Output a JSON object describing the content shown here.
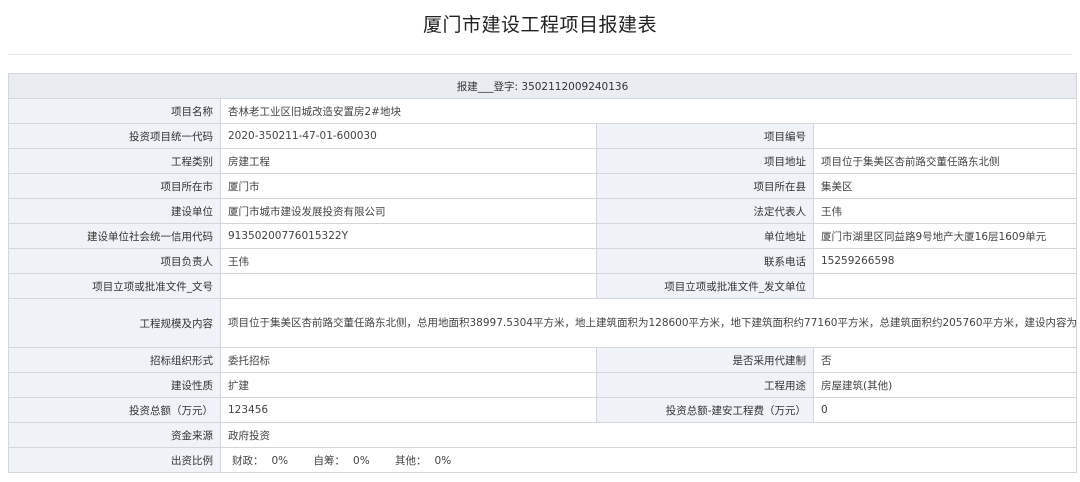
{
  "title": "厦门市建设工程项目报建表",
  "registration": {
    "prefix": "报建",
    "blank": "___",
    "suffix": "登字:",
    "number": "3502112009240136"
  },
  "rows": {
    "project_name": {
      "label": "项目名称",
      "value": "杏林老工业区旧城改造安置房2#地块"
    },
    "investment_code": {
      "label": "投资项目统一代码",
      "value": "2020-350211-47-01-600030"
    },
    "project_number": {
      "label": "项目编号",
      "value": ""
    },
    "engineering_category": {
      "label": "工程类别",
      "value": "房建工程"
    },
    "project_address": {
      "label": "项目地址",
      "value": "项目位于集美区杏前路交董任路东北侧"
    },
    "city": {
      "label": "项目所在市",
      "value": "厦门市"
    },
    "county": {
      "label": "项目所在县",
      "value": "集美区"
    },
    "construction_unit": {
      "label": "建设单位",
      "value": "厦门市城市建设发展投资有限公司"
    },
    "legal_rep": {
      "label": "法定代表人",
      "value": "王伟"
    },
    "credit_code": {
      "label": "建设单位社会统一信用代码",
      "value": "91350200776015322Y"
    },
    "unit_address": {
      "label": "单位地址",
      "value": "厦门市湖里区同益路9号地产大厦16层1609单元"
    },
    "project_leader": {
      "label": "项目负责人",
      "value": "王伟"
    },
    "phone": {
      "label": "联系电话",
      "value": "15259266598"
    },
    "approval_doc_no": {
      "label": "项目立项或批准文件_文号",
      "value": ""
    },
    "approval_doc_unit": {
      "label": "项目立项或批准文件_发文单位",
      "value": ""
    },
    "scale": {
      "label": "工程规模及内容",
      "value": "项目位于集美区杏前路交董任路东北侧，总用地面积38997.5304平方米，地上建筑面积为128600平方米，地下建筑面积约77160平方米，总建筑面积约205760平方米，建设内容为安置房及配建生鲜超市便利店、物流配送站（电商物流）。"
    },
    "bidding_form": {
      "label": "招标组织形式",
      "value": "委托招标"
    },
    "agent_system": {
      "label": "是否采用代建制",
      "value": "否"
    },
    "nature": {
      "label": "建设性质",
      "value": "扩建"
    },
    "usage": {
      "label": "工程用途",
      "value": "房屋建筑(其他)"
    },
    "total_investment": {
      "label": "投资总额（万元）",
      "value": "123456"
    },
    "installation_cost": {
      "label": "投资总额-建安工程费（万元）",
      "value": "0"
    },
    "fund_source": {
      "label": "资金来源",
      "value": "政府投资"
    },
    "funding_ratio": {
      "label": "出资比例",
      "items": [
        {
          "label": "财政：",
          "value": "0%"
        },
        {
          "label": "自筹：",
          "value": "0%"
        },
        {
          "label": "其他：",
          "value": "0%"
        }
      ]
    }
  }
}
